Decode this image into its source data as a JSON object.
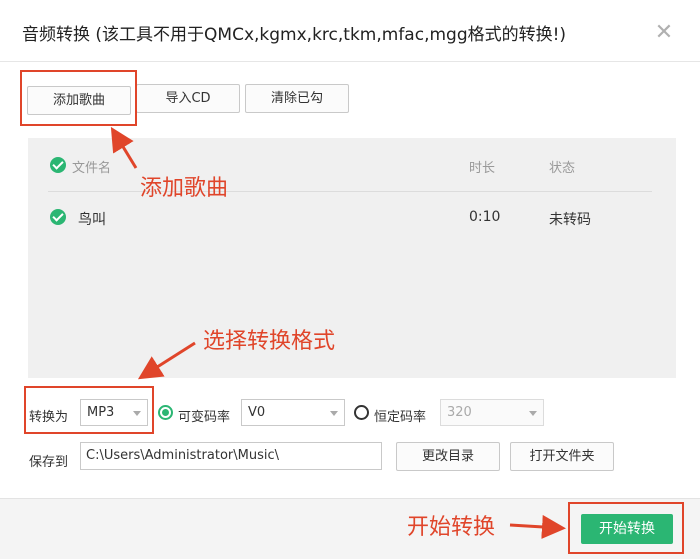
{
  "window": {
    "title": "音频转换 (该工具不用于QMCx,kgmx,krc,tkm,mfac,mgg格式的转换!)",
    "close_symbol": "✕"
  },
  "toolbar": {
    "add_song": "添加歌曲",
    "import_cd": "导入CD",
    "clear_checked": "清除已勾"
  },
  "file_list": {
    "columns": {
      "name": "文件名",
      "duration": "时长",
      "status": "状态"
    },
    "rows": [
      {
        "name": "鸟叫",
        "duration": "0:10",
        "status": "未转码",
        "checked": true
      }
    ]
  },
  "settings": {
    "convert_to_label": "转换为",
    "format_value": "MP3",
    "vbr_label": "可变码率",
    "vbr_value": "V0",
    "cbr_label": "恒定码率",
    "cbr_value": "320",
    "save_to_label": "保存到",
    "save_path": "C:\\Users\\Administrator\\Music\\",
    "change_dir": "更改目录",
    "open_folder": "打开文件夹"
  },
  "footer": {
    "start_button": "开始转换"
  },
  "annotations": {
    "add_song": "添加歌曲",
    "select_format": "选择转换格式",
    "start_convert": "开始转换"
  },
  "colors": {
    "accent_green": "#2bb673",
    "annotation_red": "#e0452a"
  },
  "icons": {
    "close": "close-icon",
    "check": "check-circle-icon",
    "arrow": "arrow-icon",
    "dropdown": "chevron-down-icon"
  }
}
